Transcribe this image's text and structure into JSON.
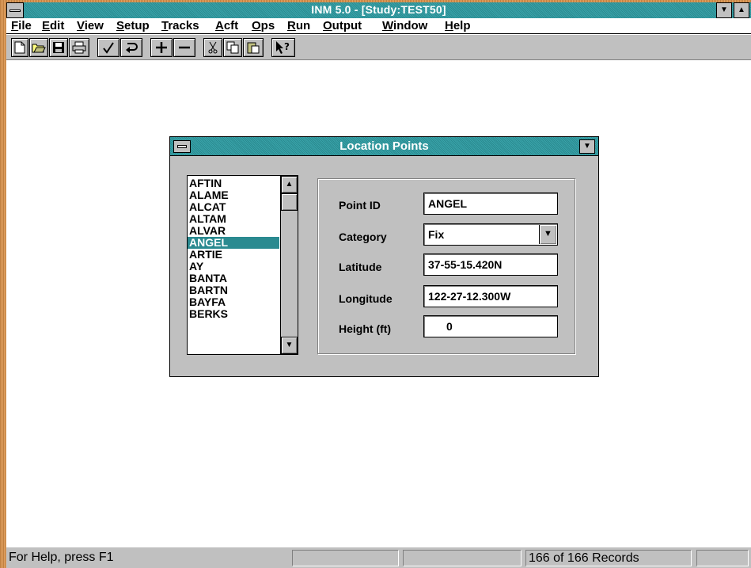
{
  "window": {
    "title": "INM 5.0 - [Study:TEST50]",
    "minimize_glyph": "▼",
    "maximize_glyph": "▲"
  },
  "menu": [
    {
      "label": "File"
    },
    {
      "label": "Edit"
    },
    {
      "label": "View"
    },
    {
      "label": "Setup"
    },
    {
      "label": "Tracks"
    },
    {
      "label": "Acft"
    },
    {
      "label": "Ops"
    },
    {
      "label": "Run"
    },
    {
      "label": "Output"
    },
    {
      "label": "Window"
    },
    {
      "label": "Help"
    }
  ],
  "toolbar": {
    "buttons": [
      {
        "name": "new-document-icon"
      },
      {
        "name": "open-folder-icon"
      },
      {
        "name": "save-disk-icon"
      },
      {
        "name": "print-icon"
      },
      {
        "name": "check-icon"
      },
      {
        "name": "undo-icon"
      },
      {
        "name": "add-record-icon"
      },
      {
        "name": "delete-record-icon"
      },
      {
        "name": "cut-icon"
      },
      {
        "name": "copy-icon"
      },
      {
        "name": "paste-icon"
      },
      {
        "name": "context-help-icon"
      }
    ]
  },
  "dialog": {
    "title": "Location Points",
    "list": {
      "items": [
        "AFTIN",
        "ALAME",
        "ALCAT",
        "ALTAM",
        "ALVAR",
        "ANGEL",
        "ARTIE",
        "AY",
        "BANTA",
        "BARTN",
        "BAYFA",
        "BERKS"
      ],
      "selected": "ANGEL",
      "scroll_up_glyph": "▲",
      "scroll_down_glyph": "▼"
    },
    "fields": {
      "point_id": {
        "label": "Point ID",
        "value": "ANGEL"
      },
      "category": {
        "label": "Category",
        "value": "Fix",
        "dropdown_glyph": "▼"
      },
      "latitude": {
        "label": "Latitude",
        "value": "37-55-15.420N"
      },
      "longitude": {
        "label": "Longitude",
        "value": "122-27-12.300W"
      },
      "height": {
        "label": "Height (ft)",
        "value": "0"
      }
    }
  },
  "status": {
    "help_text": "For Help, press F1",
    "records": "166 of 166  Records"
  },
  "colors": {
    "title_bar": "#3aa4aa",
    "selection": "#2a8a90",
    "chrome": "#c0c0c0",
    "frame": "#e0a060"
  }
}
